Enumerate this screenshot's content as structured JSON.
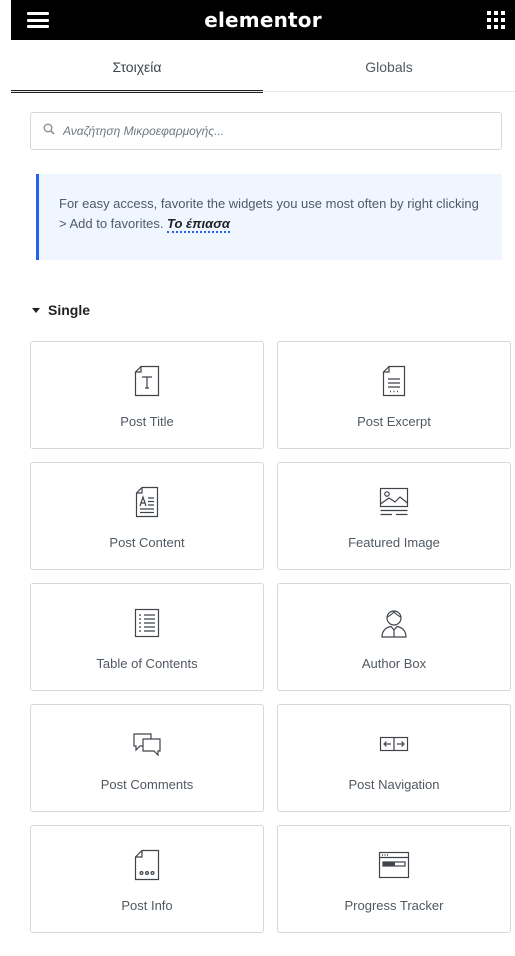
{
  "header": {
    "title": "elementor",
    "menu_icon": "hamburger-icon",
    "apps_icon": "grid-icon"
  },
  "tabs": [
    {
      "label": "Στοιχεία",
      "active": true
    },
    {
      "label": "Globals",
      "active": false
    }
  ],
  "search": {
    "placeholder": "Αναζήτηση Μικροεφαρμογής...",
    "value": "",
    "icon": "search-icon"
  },
  "notice": {
    "text": "For easy access, favorite the widgets you use most often by right clicking > Add to favorites. ",
    "link": "Το έπιασα"
  },
  "category": {
    "label": "Single",
    "expanded": true
  },
  "widgets": [
    {
      "label": "Post Title",
      "icon": "post-title-icon"
    },
    {
      "label": "Post Excerpt",
      "icon": "post-excerpt-icon"
    },
    {
      "label": "Post Content",
      "icon": "post-content-icon"
    },
    {
      "label": "Featured Image",
      "icon": "featured-image-icon"
    },
    {
      "label": "Table of Contents",
      "icon": "table-of-contents-icon"
    },
    {
      "label": "Author Box",
      "icon": "author-box-icon"
    },
    {
      "label": "Post Comments",
      "icon": "post-comments-icon"
    },
    {
      "label": "Post Navigation",
      "icon": "post-navigation-icon"
    },
    {
      "label": "Post Info",
      "icon": "post-info-icon"
    },
    {
      "label": "Progress Tracker",
      "icon": "progress-tracker-icon"
    }
  ],
  "colors": {
    "header_bg": "#000000",
    "notice_bg": "#f0f6ff",
    "accent": "#2563eb",
    "border": "#d5d8dc"
  }
}
